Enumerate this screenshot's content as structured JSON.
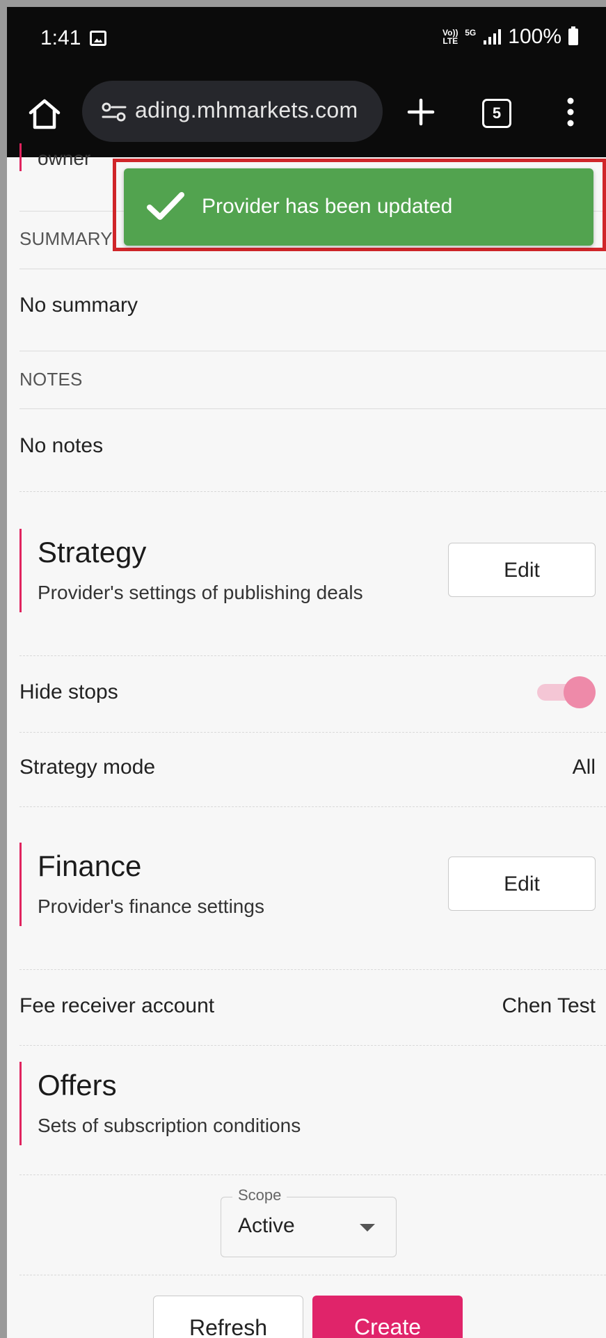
{
  "status_bar": {
    "time": "1:41",
    "network_tag_1": "Vo)) LTE",
    "network_tag_2": "5G",
    "battery": "100%"
  },
  "browser": {
    "url": "ading.mhmarkets.com",
    "tab_count": "5"
  },
  "toast": {
    "message": "Provider has been updated",
    "color": "#52a34f"
  },
  "page": {
    "owner_partial": "owner",
    "summary_label": "SUMMARY",
    "summary_value": "No summary",
    "notes_label": "NOTES",
    "notes_value": "No notes",
    "strategy": {
      "title": "Strategy",
      "subtitle": "Provider's settings of publishing deals",
      "edit_label": "Edit",
      "hide_stops_label": "Hide stops",
      "hide_stops_on": true,
      "mode_label": "Strategy mode",
      "mode_value": "All"
    },
    "finance": {
      "title": "Finance",
      "subtitle": "Provider's finance settings",
      "edit_label": "Edit",
      "fee_label": "Fee receiver account",
      "fee_value": "Chen Test"
    },
    "offers": {
      "title": "Offers",
      "subtitle": "Sets of subscription conditions",
      "scope_label": "Scope",
      "scope_value": "Active",
      "refresh_label": "Refresh",
      "create_label": "Create"
    },
    "accent_color": "#e0245e"
  }
}
